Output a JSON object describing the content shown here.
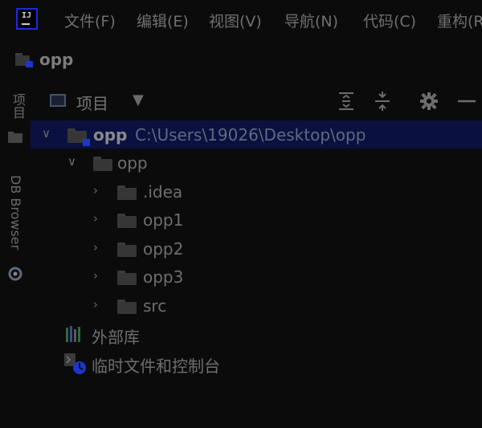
{
  "menu": {
    "logo_text": "IJ",
    "items": [
      "文件(F)",
      "编辑(E)",
      "视图(V)",
      "导航(N)",
      "代码(C)",
      "重构(R)"
    ]
  },
  "project": {
    "title": "opp"
  },
  "side_tabs": {
    "project": "项目",
    "db_browser": "DB Browser"
  },
  "tool_window": {
    "title": "项目",
    "dropdown_icon": "dropdown-arrow-icon",
    "buttons": [
      "expand-all-icon",
      "collapse-all-icon",
      "gear-icon",
      "minimize-icon"
    ]
  },
  "tree": {
    "root": {
      "name": "opp",
      "path": "C:\\Users\\19026\\Desktop\\opp",
      "expanded": true
    },
    "module": {
      "name": "opp",
      "expanded": true
    },
    "children": [
      ".idea",
      "opp1",
      "opp2",
      "opp3",
      "src"
    ],
    "external_libraries": "外部库",
    "scratches": "临时文件和控制台"
  },
  "colors": {
    "background": "#0b0b0b",
    "selection": "#0a1140",
    "accent": "#1d36c7",
    "path_text": "#5e6a80"
  }
}
